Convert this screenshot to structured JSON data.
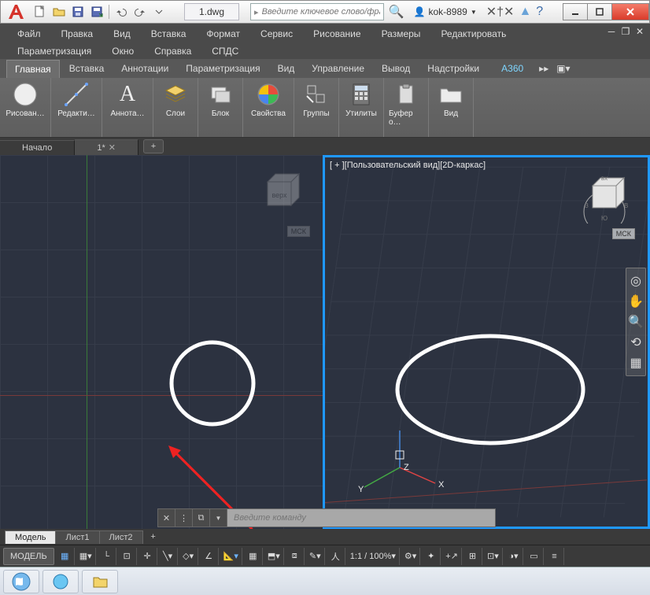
{
  "title": {
    "filename": "1.dwg",
    "search_placeholder": "Введите ключевое слово/фразу",
    "user": "kok-8989"
  },
  "menu": {
    "r1": [
      "Файл",
      "Правка",
      "Вид",
      "Вставка",
      "Формат",
      "Сервис",
      "Рисование",
      "Размеры",
      "Редактировать"
    ],
    "r2": [
      "Параметризация",
      "Окно",
      "Справка",
      "СПДС"
    ]
  },
  "ribbon_tabs": [
    "Главная",
    "Вставка",
    "Аннотации",
    "Параметризация",
    "Вид",
    "Управление",
    "Вывод",
    "Надстройки",
    "A360"
  ],
  "ribbon_extra": "▸▸",
  "panels": {
    "draw": {
      "label": "Рисован…",
      "icon": "circle"
    },
    "edit": {
      "label": "Редакти…"
    },
    "anno": {
      "label": "Аннота…",
      "icon": "A"
    },
    "layers": {
      "label": "Слои"
    },
    "block": {
      "label": "Блок"
    },
    "props": {
      "label": "Свойства"
    },
    "groups": {
      "label": "Группы"
    },
    "utils": {
      "label": "Утилиты"
    },
    "clip": {
      "label": "Буфер о…"
    },
    "view": {
      "label": "Вид"
    }
  },
  "file_tabs": {
    "start": "Начало",
    "file": "1*",
    "add": "+"
  },
  "viewport": {
    "label": "[ + ][Пользовательский вид][2D-каркас]",
    "ucs": "МСК",
    "cube": {
      "top": "верх",
      "n": "С",
      "s": "Ю",
      "w": "З",
      "e": "В"
    },
    "axes": {
      "x": "X",
      "y": "Y",
      "z": "Z"
    }
  },
  "cmd": {
    "placeholder": "Введите команду"
  },
  "layout_tabs": [
    "Модель",
    "Лист1",
    "Лист2"
  ],
  "status": {
    "model": "МОДЕЛЬ",
    "scale": "1:1 / 100%"
  }
}
